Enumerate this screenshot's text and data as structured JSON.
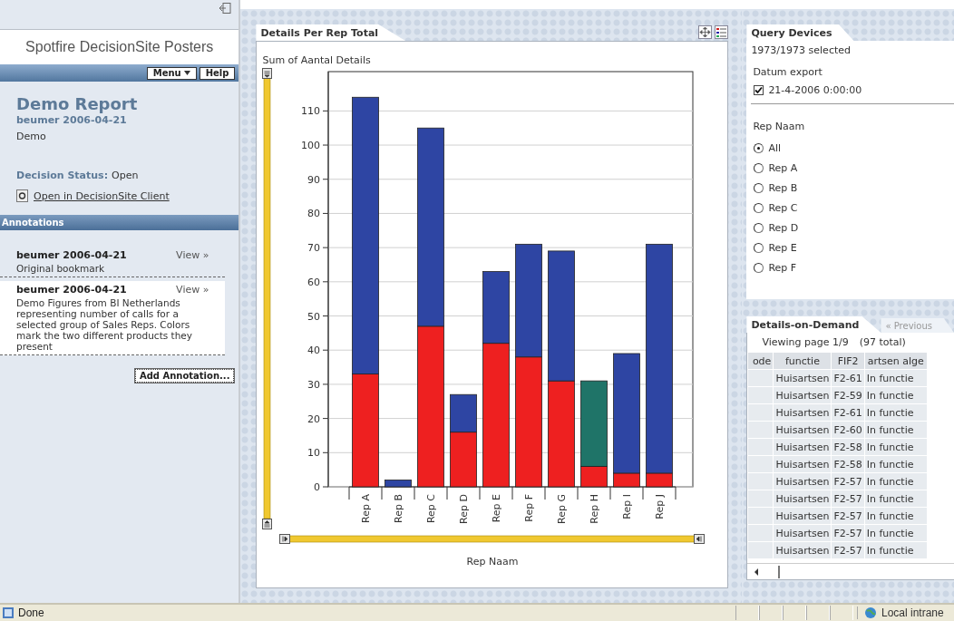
{
  "left_panel": {
    "title": "Spotfire DecisionSite Posters",
    "menu_button": "Menu",
    "help_button": "Help",
    "report": {
      "title": "Demo Report",
      "byline": "beumer 2006-04-21",
      "description": "Demo",
      "status_label": "Decision Status:",
      "status_value": "Open",
      "link": "Open in DecisionSite Client"
    },
    "annotations": {
      "header": "Annotations",
      "items": [
        {
          "author": "beumer 2006-04-21",
          "view": "View »",
          "text": "Original bookmark",
          "selected": false
        },
        {
          "author": "beumer 2006-04-21",
          "view": "View »",
          "text": "Demo Figures from BI Netherlands representing number of calls for a selected group of Sales Reps. Colors mark the two different products they present",
          "selected": true
        }
      ],
      "add_button": "Add Annotation..."
    }
  },
  "chart_panel": {
    "tab": "Details Per Rep Total",
    "chart_data": {
      "type": "bar",
      "stacked": true,
      "ylabel": "Sum of Aantal Details",
      "xlabel": "Rep Naam",
      "categories": [
        "Rep A",
        "Rep B",
        "Rep C",
        "Rep D",
        "Rep E",
        "Rep F",
        "Rep G",
        "Rep H",
        "Rep I",
        "Rep J"
      ],
      "series": [
        {
          "color": "#ee2020",
          "values": [
            33,
            0,
            47,
            16,
            42,
            38,
            31,
            6,
            4,
            4
          ]
        },
        {
          "color": "#1f7468",
          "values": [
            0,
            0,
            0,
            0,
            0,
            0,
            0,
            25,
            0,
            0
          ]
        },
        {
          "color": "#2e45a3",
          "values": [
            81,
            2,
            58,
            11,
            21,
            33,
            38,
            0,
            35,
            67
          ]
        }
      ],
      "grid": true,
      "ylim": [
        0,
        121.5
      ],
      "yticks": [
        0,
        10,
        20,
        30,
        40,
        50,
        60,
        70,
        80,
        90,
        100,
        110
      ]
    }
  },
  "query_panel": {
    "tab": "Query Devices",
    "summary": "1973/1973 selected",
    "filters": [
      {
        "kind": "checkbox",
        "label": "Datum export",
        "options": [
          {
            "label": "21-4-2006 0:00:00",
            "checked": true
          }
        ]
      },
      {
        "kind": "radio",
        "label": "Rep Naam",
        "options": [
          {
            "label": "All",
            "selected": true
          },
          {
            "label": "Rep A",
            "selected": false
          },
          {
            "label": "Rep B",
            "selected": false
          },
          {
            "label": "Rep C",
            "selected": false
          },
          {
            "label": "Rep D",
            "selected": false
          },
          {
            "label": "Rep E",
            "selected": false
          },
          {
            "label": "Rep F",
            "selected": false
          }
        ]
      }
    ]
  },
  "details_panel": {
    "tabs": [
      {
        "label": "Details-on-Demand",
        "selected": true
      },
      {
        "label": "« Previous",
        "selected": false
      }
    ],
    "paging": "Viewing page 1/9",
    "total": "(97 total)",
    "columns": [
      "ode",
      "functie",
      "FIF2",
      "artsen alge"
    ],
    "rows": [
      [
        "",
        "Huisartsen",
        "F2-61",
        "In functie"
      ],
      [
        "",
        "Huisartsen",
        "F2-59",
        "In functie"
      ],
      [
        "",
        "Huisartsen",
        "F2-61",
        "In functie"
      ],
      [
        "",
        "Huisartsen",
        "F2-60",
        "In functie"
      ],
      [
        "",
        "Huisartsen",
        "F2-58",
        "In functie"
      ],
      [
        "",
        "Huisartsen",
        "F2-58",
        "In functie"
      ],
      [
        "",
        "Huisartsen",
        "F2-57",
        "In functie"
      ],
      [
        "",
        "Huisartsen",
        "F2-57",
        "In functie"
      ],
      [
        "",
        "Huisartsen",
        "F2-57",
        "In functie"
      ],
      [
        "",
        "Huisartsen",
        "F2-57",
        "In functie"
      ],
      [
        "",
        "Huisartsen",
        "F2-57",
        "In functie"
      ]
    ]
  },
  "status_bar": {
    "text": "Done",
    "zone": "Local intrane"
  }
}
